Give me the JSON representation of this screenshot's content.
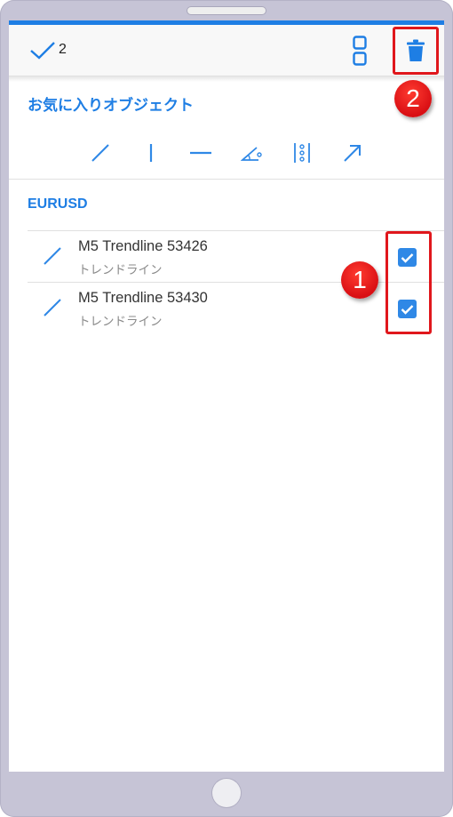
{
  "toolbar": {
    "selected_count": "2",
    "check_icon": "checkmark-icon",
    "layout_icon": "layout-toggle-icon",
    "delete_icon": "trash-icon"
  },
  "favorites": {
    "title": "お気に入りオブジェクト",
    "tools": [
      {
        "icon": "trendline-icon"
      },
      {
        "icon": "vertical-line-icon"
      },
      {
        "icon": "horizontal-line-icon"
      },
      {
        "icon": "trend-angle-icon"
      },
      {
        "icon": "fibonacci-icon"
      },
      {
        "icon": "arrow-icon"
      }
    ]
  },
  "symbol": "EURUSD",
  "objects": [
    {
      "name": "M5 Trendline 53426",
      "type": "トレンドライン",
      "checked": true
    },
    {
      "name": "M5 Trendline 53430",
      "type": "トレンドライン",
      "checked": true
    }
  ],
  "callouts": [
    {
      "label": "1"
    },
    {
      "label": "2"
    }
  ],
  "colors": {
    "accent": "#1e7ee4",
    "checkbox": "#2f88e6",
    "callout": "#e0171c"
  }
}
